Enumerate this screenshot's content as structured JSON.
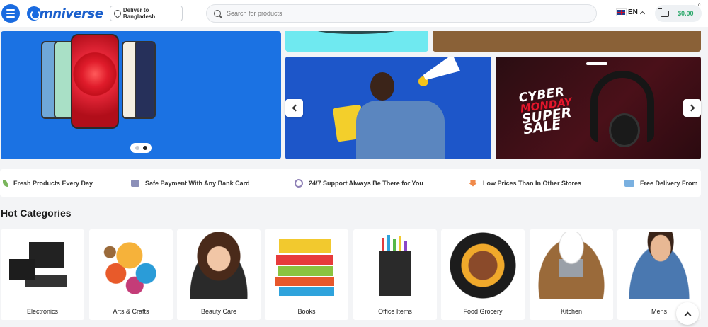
{
  "header": {
    "logo_text": "mniverse",
    "deliver_label": "Deliver to Bangladesh",
    "search_placeholder": "Search for products",
    "language": "EN",
    "cart_total": "$0.00",
    "cart_count": "0"
  },
  "banners": {
    "cyber_line1": "CYBER",
    "cyber_line2": "MONDAY",
    "cyber_line3": "SUPER",
    "cyber_line4": "SALE",
    "slider_dots": 2,
    "active_dot": 2
  },
  "features": [
    {
      "label": "Fresh Products Every Day",
      "icon": "leaf-icon"
    },
    {
      "label": "Safe Payment With Any Bank Card",
      "icon": "card-icon"
    },
    {
      "label": "24/7 Support Always Be There for You",
      "icon": "support-icon"
    },
    {
      "label": "Low Prices Than In Other Stores",
      "icon": "price-down-icon"
    },
    {
      "label": "Free Delivery From",
      "icon": "truck-icon"
    }
  ],
  "categories_title": "Hot Categories",
  "categories": [
    {
      "label": "Electronics"
    },
    {
      "label": "Arts & Crafts"
    },
    {
      "label": "Beauty Care"
    },
    {
      "label": "Books"
    },
    {
      "label": "Office Items"
    },
    {
      "label": "Food Grocery"
    },
    {
      "label": "Kitchen"
    },
    {
      "label": "Mens"
    }
  ],
  "colors": {
    "brand": "#1a6be0",
    "price": "#2aa86a",
    "sale_red": "#e3162b"
  }
}
